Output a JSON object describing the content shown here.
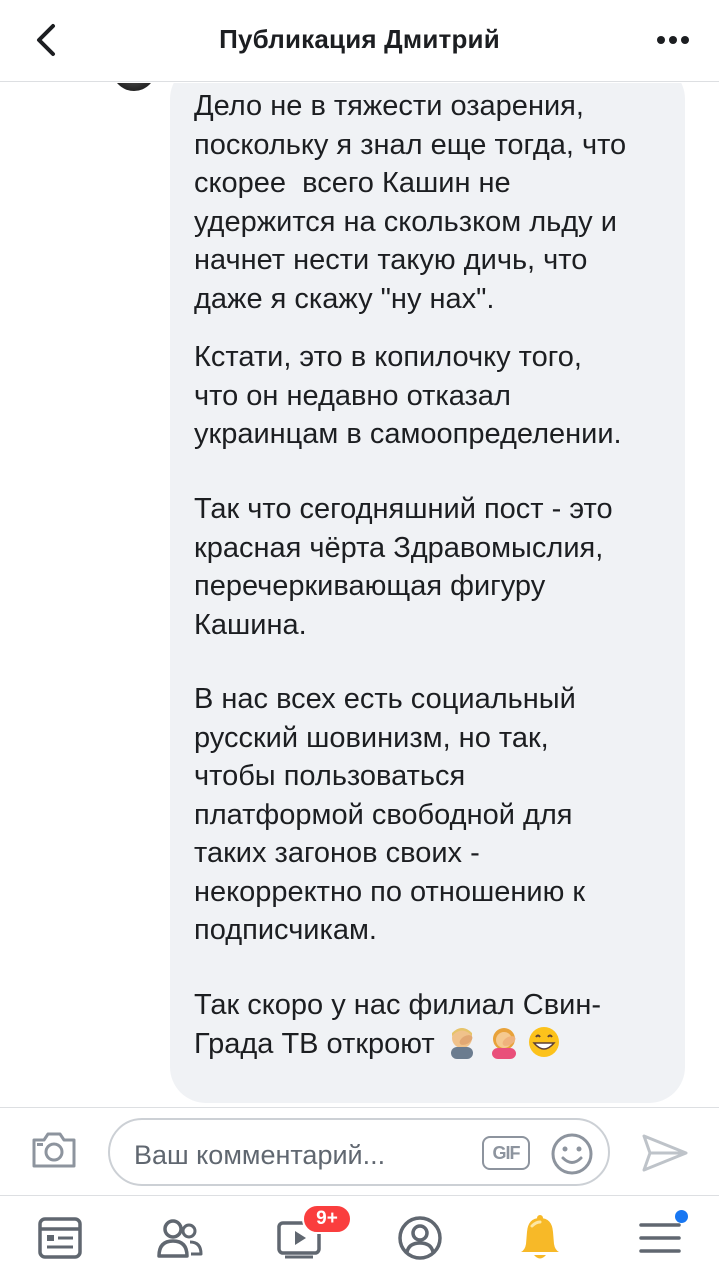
{
  "header": {
    "title": "Публикация Дмитрий",
    "back_icon": "chevron-left-icon",
    "more_icon": "more-horizontal-icon"
  },
  "comment": {
    "paragraphs": [
      "Дело не в тяжести озарения,\nпоскольку я знал еще тогда, что\nскорее  всего Кашин не\nудержится на скользком льду и\nначнет нести такую дичь, что\nдаже я скажу \"ну нах\".",
      "Кстати, это в копилочку того,\nчто он недавно отказал\nукраинцам в самоопределении.",
      "Так что сегодняшний пост - это\nкрасная чёрта Здравомыслия,\nперечеркивающая фигуру\nКашина.",
      "В нас всех есть социальный\nрусский шовинизм, но так,\nчтобы пользоваться\nплатформой свободной для\nтаких загонов своих -\nнекорректно по отношению к\nподписчикам.",
      "Так скоро у нас филиал Свин-\nГрада ТВ откроют"
    ],
    "emojis": [
      "man-facepalming-emoji",
      "woman-facepalming-emoji",
      "grinning-face-emoji"
    ]
  },
  "composer": {
    "placeholder": "Ваш комментарий...",
    "gif_label": "GIF",
    "camera_icon": "camera-icon",
    "smile_icon": "smiley-icon",
    "send_icon": "send-icon"
  },
  "tabbar": {
    "tabs": [
      "feed-icon",
      "friends-icon",
      "watch-icon",
      "profile-icon",
      "bell-icon",
      "menu-icon"
    ],
    "watch_badge": "9+",
    "accent": "#1877f2",
    "badge_color": "#fa3e3e",
    "bell_color": "#f7b928"
  }
}
